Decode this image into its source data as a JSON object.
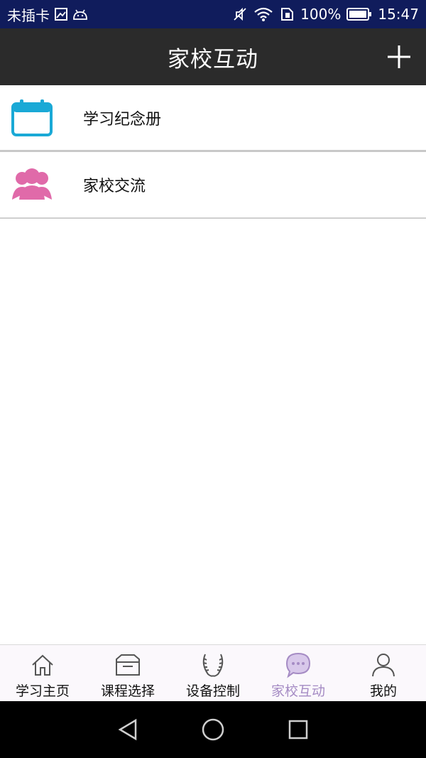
{
  "status_bar": {
    "carrier": "未插卡",
    "battery": "100%",
    "time": "15:47"
  },
  "app_bar": {
    "title": "家校互动",
    "add_icon": "plus-icon"
  },
  "list": {
    "items": [
      {
        "label": "学习纪念册",
        "icon": "calendar-icon",
        "color": "#1aa9d6"
      },
      {
        "label": "家校交流",
        "icon": "people-icon",
        "color": "#e06aa9"
      }
    ]
  },
  "tabs": [
    {
      "label": "学习主页",
      "icon": "home-icon",
      "active": false
    },
    {
      "label": "课程选择",
      "icon": "tray-icon",
      "active": false
    },
    {
      "label": "设备控制",
      "icon": "laurel-icon",
      "active": false
    },
    {
      "label": "家校互动",
      "icon": "chat-bubble-icon",
      "active": true
    },
    {
      "label": "我的",
      "icon": "person-icon",
      "active": false
    }
  ],
  "colors": {
    "status_bar_bg": "#101c5c",
    "app_bar_bg": "#2b2b2b",
    "active_tab": "#a58bc4"
  }
}
